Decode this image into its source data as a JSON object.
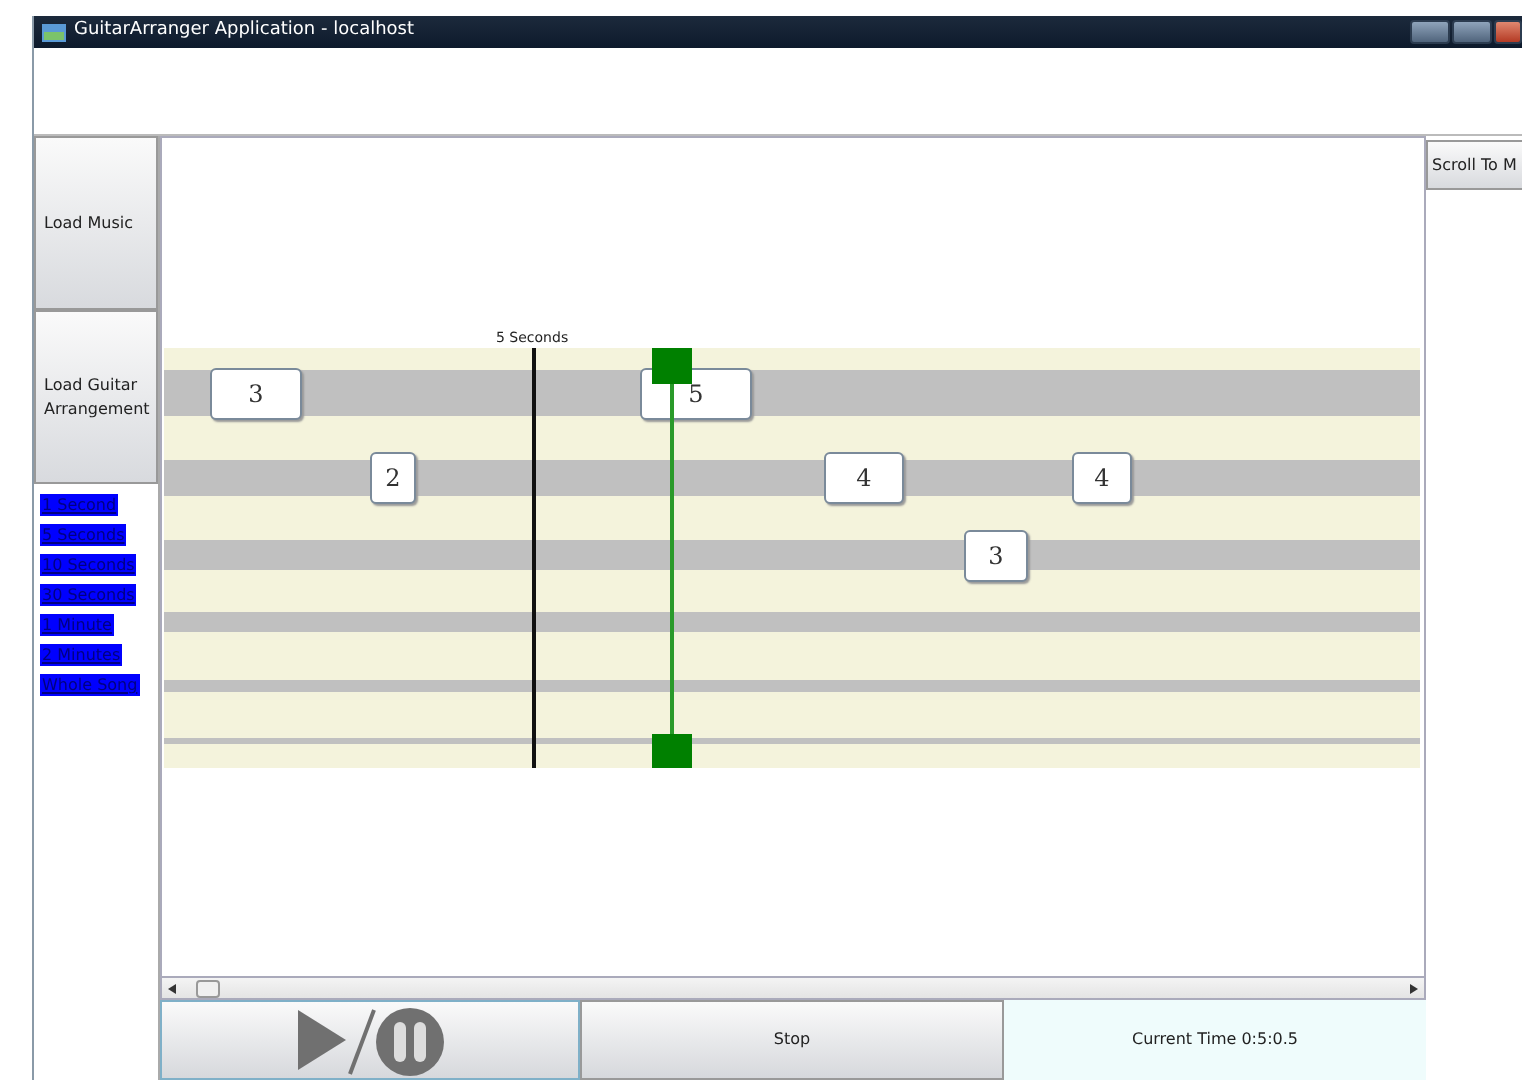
{
  "window": {
    "title": "GuitarArranger Application - localhost"
  },
  "sidebar": {
    "buttons": [
      "Load Music",
      "Load Guitar Arrangement"
    ],
    "intervals": [
      {
        "label": "1 Second"
      },
      {
        "label": "5 Seconds"
      },
      {
        "label": "10 Seconds"
      },
      {
        "label": "30 Seconds"
      },
      {
        "label": "1 Minute"
      },
      {
        "label": "2 Minutes"
      },
      {
        "label": "Whole Song"
      }
    ]
  },
  "scroll_button": "Scroll To M",
  "tab": {
    "marker": "5 Seconds",
    "strings": [
      {
        "notes": [
          "3",
          "5"
        ]
      },
      {
        "notes": [
          "2",
          "4",
          "4"
        ]
      },
      {
        "notes": [
          "3"
        ]
      }
    ]
  },
  "controls": {
    "stop": "Stop",
    "current_time": "Current Time 0:5:0.5"
  }
}
